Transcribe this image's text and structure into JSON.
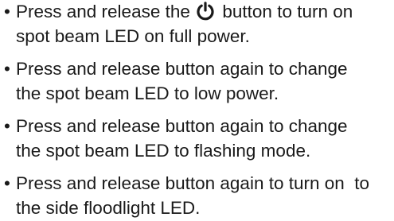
{
  "instructions": {
    "items": [
      {
        "bullet": "•",
        "line1_before_icon": "Press and release the ",
        "icon": "power-icon",
        "line1_after_icon": " button to turn on",
        "line2": "spot beam LED on full power."
      },
      {
        "bullet": "•",
        "line1": "Press and release button again to change",
        "line2": "the spot beam LED to low power."
      },
      {
        "bullet": "•",
        "line1": "Press and release button again to change",
        "line2": "the spot beam LED to flashing mode."
      },
      {
        "bullet": "•",
        "line1": "Press and release button again to turn on  to",
        "line2": "the side floodlight LED."
      }
    ]
  }
}
